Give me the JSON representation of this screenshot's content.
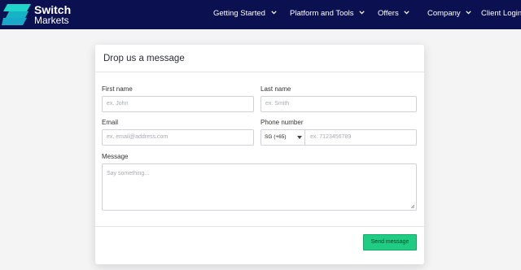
{
  "brand": {
    "name_line1": "Switch",
    "name_line2": "Markets",
    "colors": {
      "navbar_bg": "#0b1150",
      "logo_light": "#1fd4c8",
      "logo_dark": "#19a8c9",
      "accent_green": "#1fcc83"
    }
  },
  "nav": {
    "getting_started": "Getting Started",
    "platform_tools": "Platform and Tools",
    "offers": "Offers",
    "company": "Company",
    "client_login": "Client Login"
  },
  "form": {
    "title": "Drop us a message",
    "first_name": {
      "label": "First name",
      "placeholder": "ex. John"
    },
    "last_name": {
      "label": "Last name",
      "placeholder": "ex. Smith"
    },
    "email": {
      "label": "Email",
      "placeholder": "ex. email@address.com"
    },
    "phone": {
      "label": "Phone number",
      "country_code": "SG (+65)",
      "placeholder": "ex. 7123456789"
    },
    "message": {
      "label": "Message",
      "placeholder": "Say something..."
    },
    "submit_label": "Send message"
  },
  "icons": {
    "logo": "switch-markets-logo",
    "dropdown": "chevron-down-icon",
    "select_caret": "caret-down-icon",
    "resize": "resize-grip-icon"
  }
}
